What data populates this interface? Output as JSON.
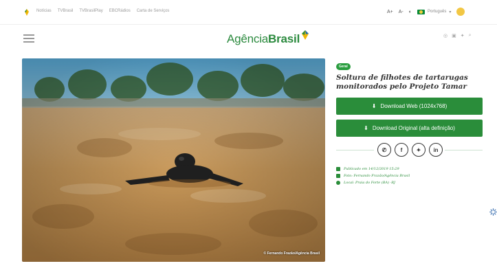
{
  "topbar": {
    "links": [
      "Notícias",
      "TVBrasil",
      "TVBrasilPlay",
      "EBCRádios",
      "Carta de Serviços"
    ],
    "font_large": "A+",
    "font_small": "A-",
    "contrast_icon": "contrast-icon",
    "language": "Português",
    "language_caret": "▾"
  },
  "header": {
    "logo_light": "Agência",
    "logo_bold": "Brasil",
    "social_icons": [
      "instagram-icon",
      "youtube-icon",
      "twitter-icon",
      "search-icon"
    ]
  },
  "photo": {
    "credit": "© Fernando Frazão/Agência Brasil"
  },
  "article": {
    "badge": "Geral",
    "title": "Soltura de filhotes de tartarugas monitorados pelo Projeto Tamar",
    "download_web": "Download Web (1024x768)",
    "download_original": "Download Original (alta definição)",
    "share_icons": [
      "whatsapp-icon",
      "facebook-icon",
      "twitter-icon",
      "linkedin-icon"
    ],
    "published": "Publicado em 14/12/2019 15:29",
    "photo_by": "Foto: Fernando Frazão/Agência Brasil",
    "location": "Local: Praia do Forte (BA) -BJ"
  },
  "colors": {
    "accent": "#2a8d3a",
    "badge": "#2a9d3f"
  }
}
